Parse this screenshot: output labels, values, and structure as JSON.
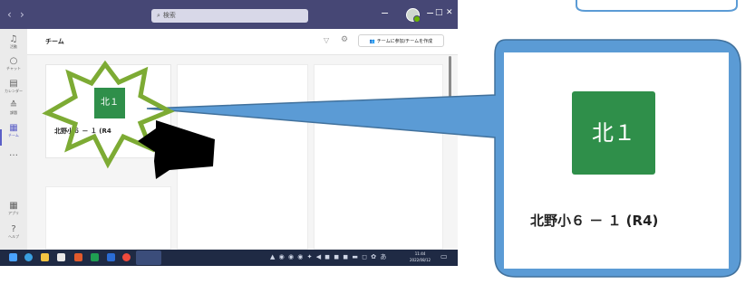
{
  "titlebar": {
    "back_icon": "chevron-left",
    "forward_icon": "chevron-right",
    "search_placeholder": "検索",
    "minimize_glyph": "−",
    "maximize_glyph": "□",
    "close_glyph": "✕",
    "more_glyph": "−"
  },
  "rail": {
    "items": [
      {
        "label": "活動",
        "icon": "bell-icon"
      },
      {
        "label": "チャット",
        "icon": "chat-icon"
      },
      {
        "label": "カレンダー",
        "icon": "calendar-icon"
      },
      {
        "label": "課題",
        "icon": "assignments-icon"
      },
      {
        "label": "チーム",
        "icon": "teams-icon",
        "active": true
      },
      {
        "label": "…",
        "icon": "more-icon"
      },
      {
        "label": "アプリ",
        "icon": "apps-icon"
      },
      {
        "label": "ヘルプ",
        "icon": "help-icon"
      }
    ]
  },
  "header": {
    "title": "チーム",
    "join_button": "チームに参加/チームを作成"
  },
  "team_card": {
    "tile_text": "北１",
    "name": "北野小６ － １ (R4"
  },
  "callout": {
    "tile_text": "北１",
    "team_name": "北野小６ － １ (R4)"
  },
  "taskbar": {
    "time": "11:44",
    "date": "2022/08/12",
    "ime": "あ"
  },
  "colors": {
    "titlebar": "#464775",
    "tile_green": "#2f8f4a",
    "callout_blue": "#5b9bd5",
    "star_green": "#7dab34"
  }
}
